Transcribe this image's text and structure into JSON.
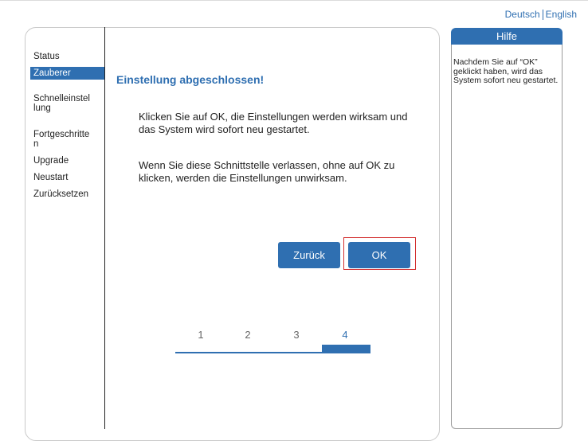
{
  "header": {
    "lang_de": "Deutsch",
    "lang_en": "English"
  },
  "sidebar": {
    "items": [
      {
        "label": "Status"
      },
      {
        "label": "Zauberer"
      },
      {
        "label": "Schnelleinstel\nlung"
      },
      {
        "label": "Fortgeschritte\nn"
      },
      {
        "label": "Upgrade"
      },
      {
        "label": "Neustart"
      },
      {
        "label": "Zurücksetzen"
      }
    ],
    "active_index": 1
  },
  "main": {
    "title": "Einstellung abgeschlossen!",
    "paragraph1": "Klicken Sie auf OK, die Einstellungen werden wirksam und das System wird sofort neu gestartet.",
    "paragraph2": "Wenn Sie diese Schnittstelle verlassen, ohne auf OK zu klicken, werden die Einstellungen unwirksam.",
    "back_label": "Zurück",
    "ok_label": "OK"
  },
  "steps": {
    "labels": [
      "1",
      "2",
      "3",
      "4"
    ],
    "current": 4
  },
  "help": {
    "title": "Hilfe",
    "text": "Nachdem Sie auf “OK” geklickt haben, wird das System sofort neu gestartet."
  },
  "colors": {
    "accent": "#2f6fb1",
    "highlight": "#d32f2f"
  }
}
